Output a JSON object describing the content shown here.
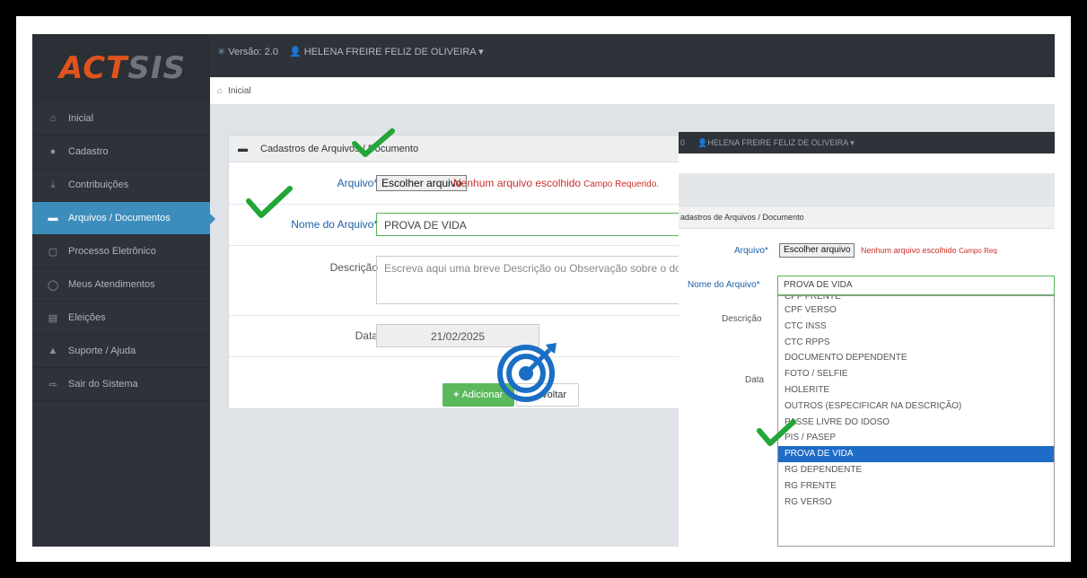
{
  "app": {
    "logo_primary": "ACT",
    "logo_secondary": "SIS"
  },
  "topbar": {
    "version": "Versão: 2.0",
    "user": "HELENA FREIRE FELIZ DE OLIVEIRA ▾"
  },
  "breadcrumb": {
    "home": "Inicial"
  },
  "sidebar": {
    "items": [
      {
        "label": "Inicial",
        "icon": "home-icon"
      },
      {
        "label": "Cadastro",
        "icon": "user-icon"
      },
      {
        "label": "Contribuições",
        "icon": "download-icon"
      },
      {
        "label": "Arquivos / Documentos",
        "icon": "archive-icon",
        "active": true
      },
      {
        "label": "Processo Eletrônico",
        "icon": "file-icon"
      },
      {
        "label": "Meus Atendimentos",
        "icon": "chat-icon"
      },
      {
        "label": "Eleições",
        "icon": "ballot-icon"
      },
      {
        "label": "Suporte / Ajuda",
        "icon": "warning-icon"
      },
      {
        "label": "Sair do Sistema",
        "icon": "logout-icon"
      }
    ]
  },
  "form": {
    "title": "Cadastros de Arquivos / Documento",
    "arquivo_label": "Arquivo*",
    "choose_file_label": "Escolher arquivo",
    "no_file_text": "Nenhum arquivo escolhido",
    "required_text": "Campo Requerido.",
    "nome_label": "Nome do Arquivo*",
    "nome_value": "PROVA DE VIDA",
    "descricao_label": "Descrição",
    "descricao_placeholder": "Escreva aqui uma breve Descrição ou Observação sobre o documento",
    "data_label": "Data",
    "data_value": "21/02/2025",
    "add_button": "Adicionar",
    "back_button": "Voltar"
  },
  "overlay": {
    "topbar_user": "HELENA FREIRE FELIZ DE OLIVEIRA ▾",
    "panel_title": "adastros de Arquivos / Documento",
    "arquivo_label": "Arquivo*",
    "choose_file_label": "Escolher arquivo",
    "no_file_text": "Nenhum arquivo escolhido",
    "required_text": "Campo Req",
    "nome_label": "Nome do Arquivo*",
    "selected_value": "PROVA DE VIDA",
    "descricao_label": "Descrição",
    "data_label": "Data",
    "options": [
      "CPF FRENTE",
      "CPF VERSO",
      "CTC INSS",
      "CTC RPPS",
      "DOCUMENTO DEPENDENTE",
      "FOTO / SELFIE",
      "HOLERITE",
      "OUTROS (ESPECIFICAR NA DESCRIÇÃO)",
      "PASSE LIVRE DO IDOSO",
      "PIS / PASEP",
      "PROVA DE VIDA",
      "RG DEPENDENTE",
      "RG FRENTE",
      "RG VERSO"
    ],
    "selected_index": 10
  },
  "colors": {
    "accent": "#3c8dbc",
    "check": "#22a638",
    "target": "#1a6fc4",
    "brand": "#e0531c"
  }
}
